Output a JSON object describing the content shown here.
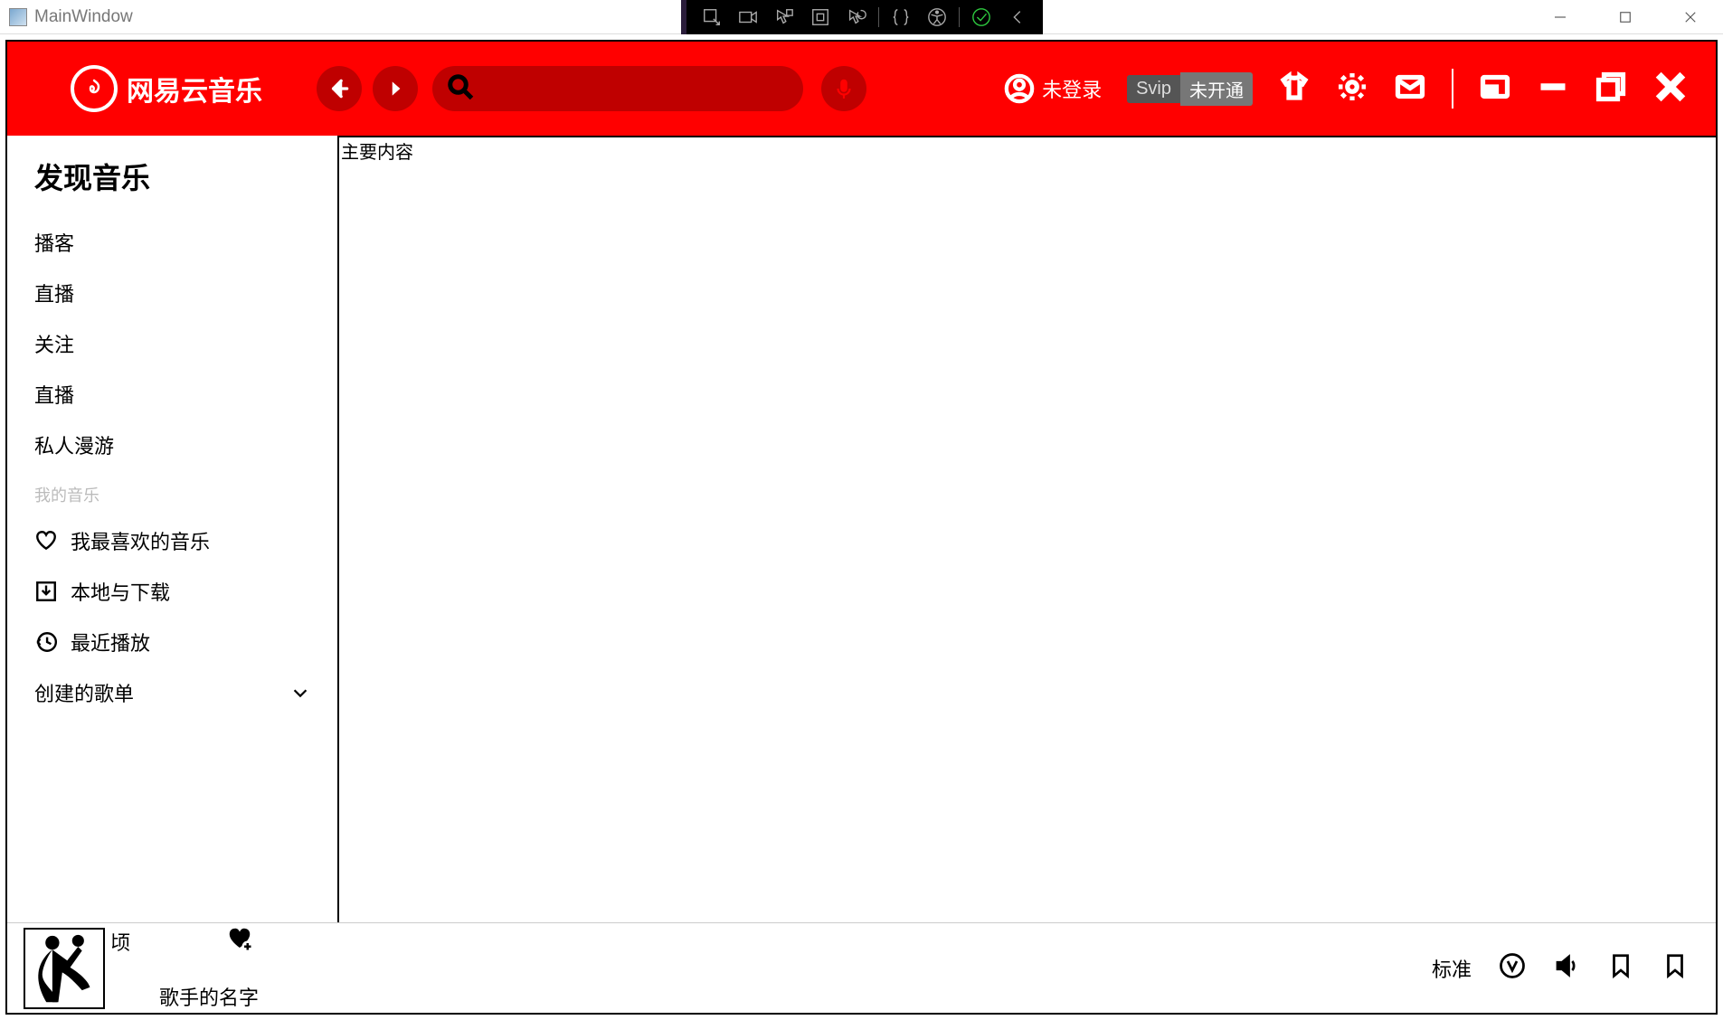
{
  "window": {
    "title": "MainWindow"
  },
  "header": {
    "logo_text": "网易云音乐",
    "login_text": "未登录",
    "svip_label": "Svip",
    "svip_status": "未开通",
    "search_value": ""
  },
  "sidebar": {
    "title": "发现音乐",
    "items": [
      "播客",
      "直播",
      "关注",
      "直播",
      "私人漫游"
    ],
    "sub_section": "我的音乐",
    "favorites": "我最喜欢的音乐",
    "local": "本地与下载",
    "recent": "最近播放",
    "created": "创建的歌单"
  },
  "main": {
    "label": "主要内容"
  },
  "player": {
    "meta_suffix": "顷",
    "singer": "歌手的名字",
    "quality": "标准"
  }
}
